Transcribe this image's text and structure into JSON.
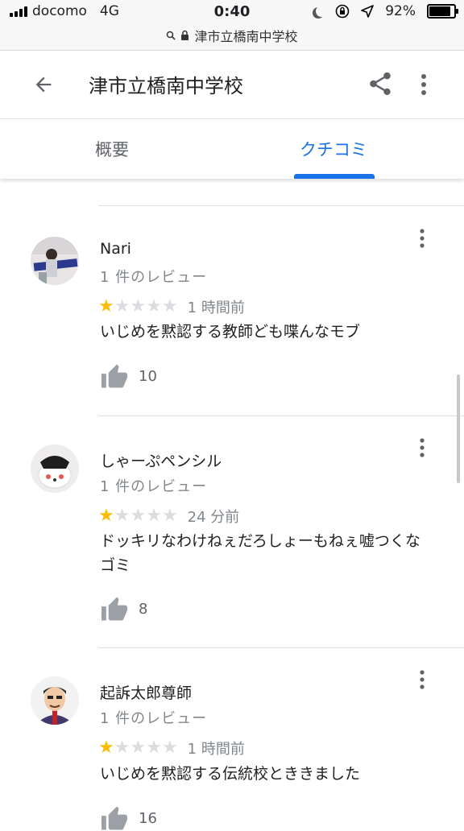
{
  "status_bar": {
    "carrier": "docomo",
    "network": "4G",
    "time": "0:40",
    "battery": "92%",
    "battery_level": 0.92,
    "url": "津市立橋南中学校"
  },
  "header": {
    "title": "津市立橋南中学校"
  },
  "tabs": {
    "overview": "概要",
    "reviews": "クチコミ",
    "active": "reviews"
  },
  "colors": {
    "accent": "#1a73e8",
    "star_on": "#fbbc04",
    "star_off": "#dadce0"
  },
  "reviews": [
    {
      "name": "Nari",
      "review_count": "1 件のレビュー",
      "rating": 1,
      "max_rating": 5,
      "time": "1 時間前",
      "text": "いじめを黙認する教師ども喋んなモブ",
      "likes": "10"
    },
    {
      "name": "しゃーぷペンシル",
      "review_count": "1 件のレビュー",
      "rating": 1,
      "max_rating": 5,
      "time": "24 分前",
      "text": "ドッキリなわけねぇだろしょーもねぇ嘘つくなゴミ",
      "likes": "8"
    },
    {
      "name": "起訴太郎尊師",
      "review_count": "1 件のレビュー",
      "rating": 1,
      "max_rating": 5,
      "time": "1 時間前",
      "text": "いじめを黙認する伝統校とききました",
      "likes": "16"
    }
  ]
}
